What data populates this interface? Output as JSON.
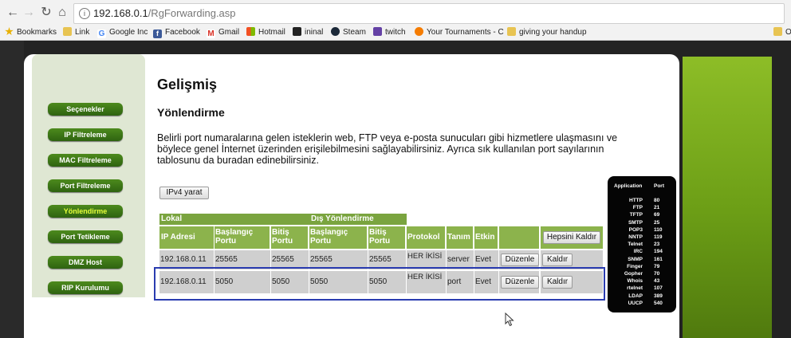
{
  "browser": {
    "nav_icons": [
      "back-icon",
      "forward-icon",
      "reload-icon",
      "home-icon"
    ],
    "url_host": "192.168.0.1",
    "url_path": "/RgForwarding.asp",
    "bookmarks": [
      {
        "label": "Bookmarks",
        "icon": "star-icon",
        "color": "#e8b000"
      },
      {
        "label": "Link",
        "icon": "folder-icon",
        "color": "#e8c452"
      },
      {
        "label": "Google Inc",
        "icon": "google-icon",
        "color": "#4285f4"
      },
      {
        "label": "Facebook",
        "icon": "facebook-icon",
        "color": "#3b5998"
      },
      {
        "label": "Gmail",
        "icon": "gmail-icon",
        "color": "#d93025"
      },
      {
        "label": "Hotmail",
        "icon": "windows-icon",
        "color": "#00a4ef"
      },
      {
        "label": "ininal",
        "icon": "ininal-icon",
        "color": "#222222"
      },
      {
        "label": "Steam",
        "icon": "steam-icon",
        "color": "#1b2838"
      },
      {
        "label": "twitch",
        "icon": "twitch-icon",
        "color": "#6441a5"
      },
      {
        "label": "Your Tournaments - C",
        "icon": "tournament-icon",
        "color": "#f57c00"
      },
      {
        "label": "giving your handup",
        "icon": "folder-icon",
        "color": "#e8c452"
      },
      {
        "label": "O",
        "icon": "folder-icon",
        "color": "#e8c452"
      }
    ]
  },
  "sidebar": {
    "items": [
      {
        "label": "Seçenekler",
        "active": false
      },
      {
        "label": "IP Filtreleme",
        "active": false
      },
      {
        "label": "MAC Filtreleme",
        "active": false
      },
      {
        "label": "Port Filtreleme",
        "active": false
      },
      {
        "label": "Yönlendirme",
        "active": true
      },
      {
        "label": "Port Tetikleme",
        "active": false
      },
      {
        "label": "DMZ Host",
        "active": false
      },
      {
        "label": "RIP Kurulumu",
        "active": false
      }
    ]
  },
  "main": {
    "title": "Gelişmiş",
    "subtitle": "Yönlendirme",
    "description": "Belirli port numaralarına gelen isteklerin web, FTP veya e-posta sunucuları gibi hizmetlere ulaşmasını ve böylece genel İnternet üzerinden erişilebilmesini sağlayabilirsiniz. Ayrıca sık kullanılan port sayılarının tablosunu da buradan edinebilirsiniz.",
    "ipv4_button": "IPv4 yarat"
  },
  "table": {
    "group_local": "Lokal",
    "group_external": "Dış Yönlendirme",
    "headers": {
      "ip": "IP Adresi",
      "local_start": "Başlangıç Portu",
      "local_end": "Bitiş Portu",
      "ext_start": "Başlangıç Portu",
      "ext_end": "Bitiş Portu",
      "protocol": "Protokol",
      "desc": "Tanım",
      "enabled": "Etkin"
    },
    "remove_all": "Hepsini Kaldır",
    "rows": [
      {
        "ip": "192.168.0.11",
        "local_start": "25565",
        "local_end": "25565",
        "ext_start": "25565",
        "ext_end": "25565",
        "protocol": "HER İKİSİ",
        "desc": "server",
        "enabled": "Evet",
        "edit": "Düzenle",
        "remove": "Kaldır"
      },
      {
        "ip": "192.168.0.11",
        "local_start": "5050",
        "local_end": "5050",
        "ext_start": "5050",
        "ext_end": "5050",
        "protocol": "HER İKİSİ",
        "desc": "port",
        "enabled": "Evet",
        "edit": "Düzenle",
        "remove": "Kaldır"
      }
    ]
  },
  "port_list": {
    "header_app": "Application",
    "header_port": "Port",
    "rows": [
      {
        "app": "HTTP",
        "port": "80"
      },
      {
        "app": "FTP",
        "port": "21"
      },
      {
        "app": "TFTP",
        "port": "69"
      },
      {
        "app": "SMTP",
        "port": "25"
      },
      {
        "app": "POP3",
        "port": "110"
      },
      {
        "app": "NNTP",
        "port": "119"
      },
      {
        "app": "Telnet",
        "port": "23"
      },
      {
        "app": "IRC",
        "port": "194"
      },
      {
        "app": "SNMP",
        "port": "161"
      },
      {
        "app": "Finger",
        "port": "79"
      },
      {
        "app": "Gopher",
        "port": "70"
      },
      {
        "app": "Whois",
        "port": "43"
      },
      {
        "app": "rtelnet",
        "port": "107"
      },
      {
        "app": "LDAP",
        "port": "389"
      },
      {
        "app": "UUCP",
        "port": "540"
      }
    ]
  },
  "colors": {
    "selection_box": "#2a3cb0",
    "nav_green": "#3d7a18",
    "table_header": "#7aa43f"
  }
}
